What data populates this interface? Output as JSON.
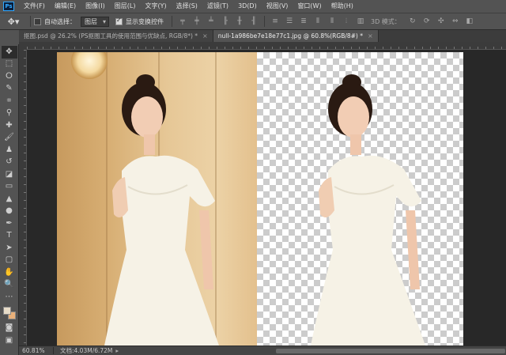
{
  "app": {
    "logo": "Ps"
  },
  "menu": [
    {
      "label": "文件(F)"
    },
    {
      "label": "编辑(E)"
    },
    {
      "label": "图像(I)"
    },
    {
      "label": "图层(L)"
    },
    {
      "label": "文字(Y)"
    },
    {
      "label": "选择(S)"
    },
    {
      "label": "滤镜(T)"
    },
    {
      "label": "3D(D)"
    },
    {
      "label": "视图(V)"
    },
    {
      "label": "窗口(W)"
    },
    {
      "label": "帮助(H)"
    }
  ],
  "options": {
    "auto_select_label": "自动选择：",
    "auto_select_checked": false,
    "auto_select_target": "图层",
    "show_transform_label": "显示变换控件",
    "show_transform_checked": true,
    "mode3d_label": "3D 模式："
  },
  "tabs": [
    {
      "label": "抠图.psd @ 26.2% (PS抠图工具的使用范围与优缺点, RGB/8*) *",
      "active": false
    },
    {
      "label": "null-1a986be7e18e77c1.jpg @ 60.8%(RGB/8#) *",
      "active": true
    }
  ],
  "tools": [
    {
      "icon": "move-icon",
      "glyph": "✥"
    },
    {
      "icon": "marquee-icon",
      "glyph": "⬚"
    },
    {
      "icon": "lasso-icon",
      "glyph": "ⵔ"
    },
    {
      "icon": "quick-select-icon",
      "glyph": "✎"
    },
    {
      "icon": "crop-icon",
      "glyph": "⌗"
    },
    {
      "icon": "eyedropper-icon",
      "glyph": "⚲"
    },
    {
      "icon": "healing-brush-icon",
      "glyph": "✚"
    },
    {
      "icon": "brush-icon",
      "glyph": "🖌"
    },
    {
      "icon": "clone-stamp-icon",
      "glyph": "♟"
    },
    {
      "icon": "history-brush-icon",
      "glyph": "↺"
    },
    {
      "icon": "eraser-icon",
      "glyph": "◪"
    },
    {
      "icon": "gradient-icon",
      "glyph": "▭"
    },
    {
      "icon": "blur-icon",
      "glyph": "▲"
    },
    {
      "icon": "dodge-icon",
      "glyph": "●"
    },
    {
      "icon": "pen-icon",
      "glyph": "✒"
    },
    {
      "icon": "type-icon",
      "glyph": "T"
    },
    {
      "icon": "path-select-icon",
      "glyph": "➤"
    },
    {
      "icon": "rectangle-icon",
      "glyph": "▢"
    },
    {
      "icon": "hand-icon",
      "glyph": "✋"
    },
    {
      "icon": "zoom-icon",
      "glyph": "🔍"
    },
    {
      "icon": "more-tools-icon",
      "glyph": "⋯"
    }
  ],
  "colors": {
    "foreground": "#e7dcc8",
    "background": "#e8b07a"
  },
  "status": {
    "zoom": "60.81%",
    "doc_info": "文档:4.03M/6.72M"
  }
}
